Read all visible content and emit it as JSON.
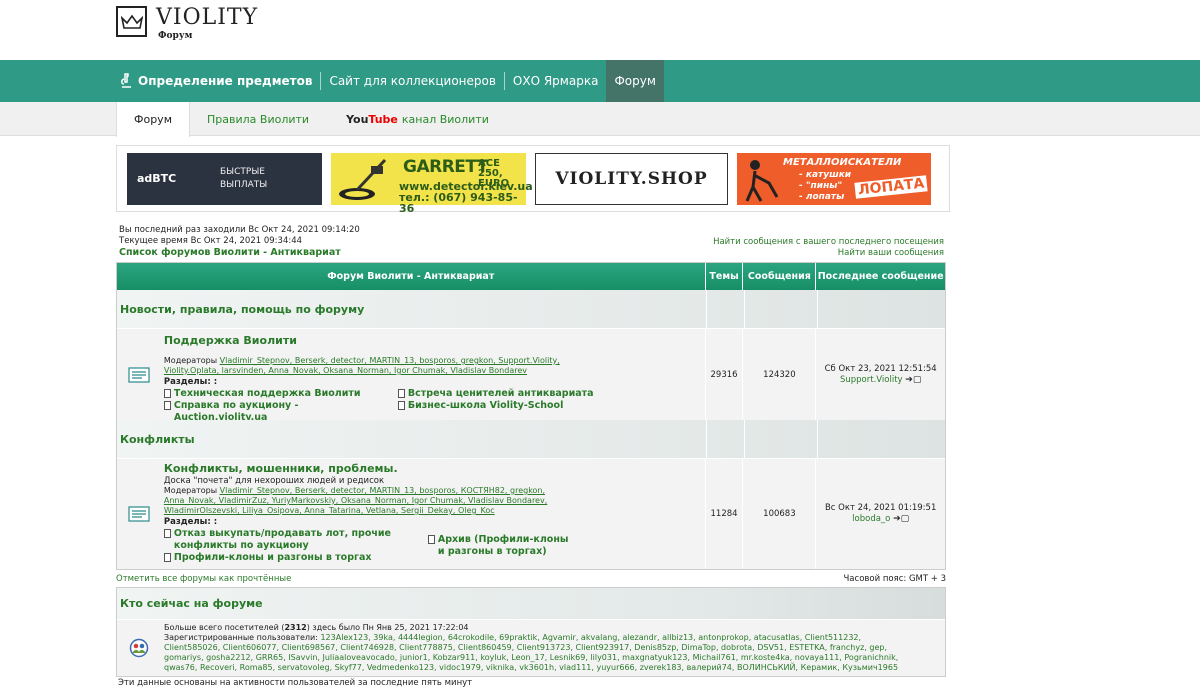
{
  "logo": {
    "title": "VIOLITY",
    "subtitle": "Форум"
  },
  "main_nav": {
    "items": [
      {
        "label": "Определение предметов"
      },
      {
        "label": "Сайт для коллекционеров"
      },
      {
        "label": "ОХО Ярмарка"
      },
      {
        "label": "Форум"
      }
    ],
    "active": "Форум"
  },
  "sub_nav": {
    "items": [
      {
        "label": "Форум"
      },
      {
        "label": "Правила Виолити"
      }
    ],
    "youtube": {
      "you": "You",
      "tube": "Tube",
      "rest": "канал Виолити"
    }
  },
  "banners": {
    "adbtc": {
      "brand": "adBTC",
      "text1": "БЫСТРЫЕ",
      "text2": "ВЫПЛАТЫ"
    },
    "garrett": {
      "brand": "GARRETT",
      "model1": "ACE 250,",
      "model2": "EURO",
      "site": "www.detector.kiev.ua",
      "phone": "тел.: (067) 943-85-36"
    },
    "shop": {
      "text": "VIOLITY.SHOP"
    },
    "metal": {
      "title": "МЕТАЛЛОИСКАТЕЛИ",
      "l1": "- катушки",
      "l2": "- \"пины\"",
      "l3": "- лопаты",
      "badge": "ЛОПАТА"
    }
  },
  "info": {
    "last_visit": "Вы последний раз заходили Вс Окт 24, 2021 09:14:20",
    "current_time": "Текущее время Вс Окт 24, 2021 09:34:44",
    "breadcrumb": "Список форумов Виолити - Антиквариат",
    "link_since_last": "Найти сообщения с вашего последнего посещения",
    "link_your_posts": "Найти ваши сообщения"
  },
  "table": {
    "headers": {
      "forum": "Форум Виолити - Антиквариат",
      "topics": "Темы",
      "posts": "Сообщения",
      "last": "Последнее сообщение"
    },
    "categories": [
      {
        "name": "Новости, правила, помощь по форуму"
      },
      {
        "name": "Конфликты"
      }
    ],
    "forums": [
      {
        "title": "Поддержка Виолити",
        "description": "",
        "mods_label": "Модераторы",
        "mods_line1": "Vladimir_Stepnov, Berserk, detector, MARTIN_13, bosporos, gregkon, Support.Violity,",
        "mods_line2": "Violity.Oplata, larsvinden, Anna_Novak, Oksana_Norman, Igor Chumak, Vladislav Bondarev",
        "mods_line3": "",
        "sections_label": "Разделы: :",
        "subforums": [
          "Техническая поддержка Виолити",
          "Справка по аукциону - Auction.violity.ua",
          "Встреча ценителей антиквариата",
          "Бизнес-школа Violity-School"
        ],
        "topics": "29316",
        "posts": "124320",
        "last_date": "Сб Окт 23, 2021 12:51:54",
        "last_user": "Support.Violity"
      },
      {
        "title": "Конфликты, мошенники, проблемы.",
        "description": "Доска \"почета\" для нехороших людей и редисок",
        "mods_label": "Модераторы",
        "mods_line1": "Vladimir_Stepnov, Berserk, detector, MARTIN_13, bosporos, КОСТЯН82, gregkon,",
        "mods_line2": "Anna_Novak, VladimirZuz, YuriyMarkovskiy, Oksana_Norman, Igor Chumak, Vladislav Bondarev,",
        "mods_line3": "WladimirOlszevski, Liliya_Osipova, Anna_Tatarina, Vetlana, Sergii_Dekay, Oleg_Koc",
        "sections_label": "Разделы: :",
        "subforums": [
          "Отказ выкупать/продавать лот, прочие конфликты по аукциону",
          "Профили-клоны и разгоны в торгах",
          "Архив (Профили-клоны и разгоны в торгах)"
        ],
        "topics": "11284",
        "posts": "100683",
        "last_date": "Вс Окт 24, 2021 01:19:51",
        "last_user": "loboda_o"
      }
    ]
  },
  "mark_read": "Отметить все форумы как прочтённые",
  "timezone": "Часовой пояс: GMT + 3",
  "whois": {
    "title": "Кто сейчас на форуме",
    "record_pre": "Больше всего посетителей (",
    "record_num": "2312",
    "record_post": ") здесь было Пн Янв 25, 2021 17:22:04",
    "registered_label": "Зарегистрированные пользователи:",
    "users_line1": "123Alex123, 39ka, 4444legion, 64crokodile, 69praktik, Agvamir, akvalang, alezandr, allbiz13, antonprokop, atacusatlas, Client511232,",
    "users_line2": "Client585026, Client606077, Client698567, Client746928, Client778875, Client860459, Client913723, Client923917, Denis85zp, DimaTop, dobrota, DSV51, ESTETKA, franchyz, gep,",
    "users_line3": "gomariys, gosha2212, GRR65, ISavvin, Juliaaloveavocado, junior1, Kobzar911, koyluk, Leon_17, Lesnik69, lily031, maxgnatyuk123, Michail761, mr.koste4ka, novaya111, Pogranichnik,",
    "users_line4": "qwas76, Recoveri, Roma85, servatovoleg, Skyf77, Vedmedenko123, vidoc1979, viknika, vk3601h, vlad111, yuyur666, zverek183, валерий74, ВОЛИНСЬКИЙ, Керамик, Кузьмич1965"
  },
  "footnote": "Эти данные основаны на активности пользователей за последние пять минут",
  "colors": {
    "nav": "#2f9a85",
    "nav_active": "#447468",
    "link": "#2a7a2a",
    "header_green": "#1e9a70"
  }
}
